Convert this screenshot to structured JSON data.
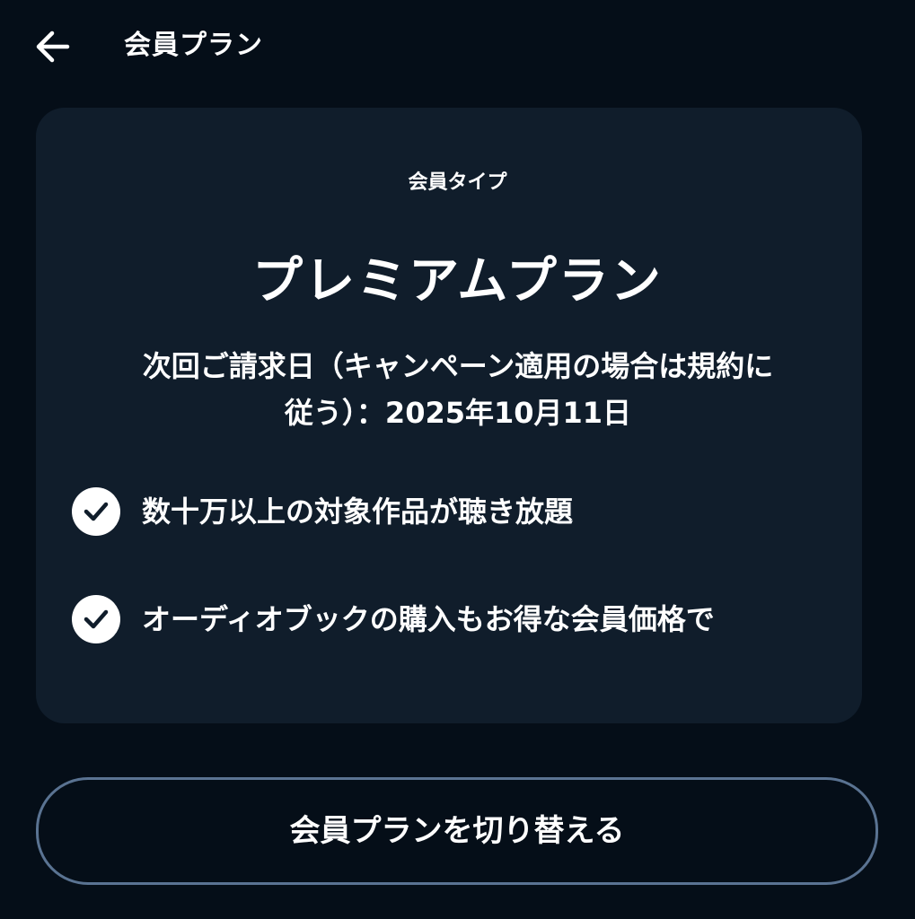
{
  "header": {
    "title": "会員プラン",
    "back_icon": "arrow-left-icon"
  },
  "card": {
    "plan_type_label": "会員タイプ",
    "plan_name": "プレミアムプラン",
    "billing_line1": "次回ご請求日（キャンペーン適用の場合は規約に",
    "billing_line2": "従う）：2025年10月11日",
    "features": [
      {
        "text": "数十万以上の対象作品が聴き放題",
        "icon": "check-circle-icon"
      },
      {
        "text": "オーディオブックの購入もお得な会員価格で",
        "icon": "check-circle-icon"
      }
    ]
  },
  "switch_button": {
    "label": "会員プランを切り替える"
  },
  "colors": {
    "background": "#050e18",
    "card": "#101d2b",
    "button_border": "#5a7392",
    "text": "#ffffff"
  }
}
